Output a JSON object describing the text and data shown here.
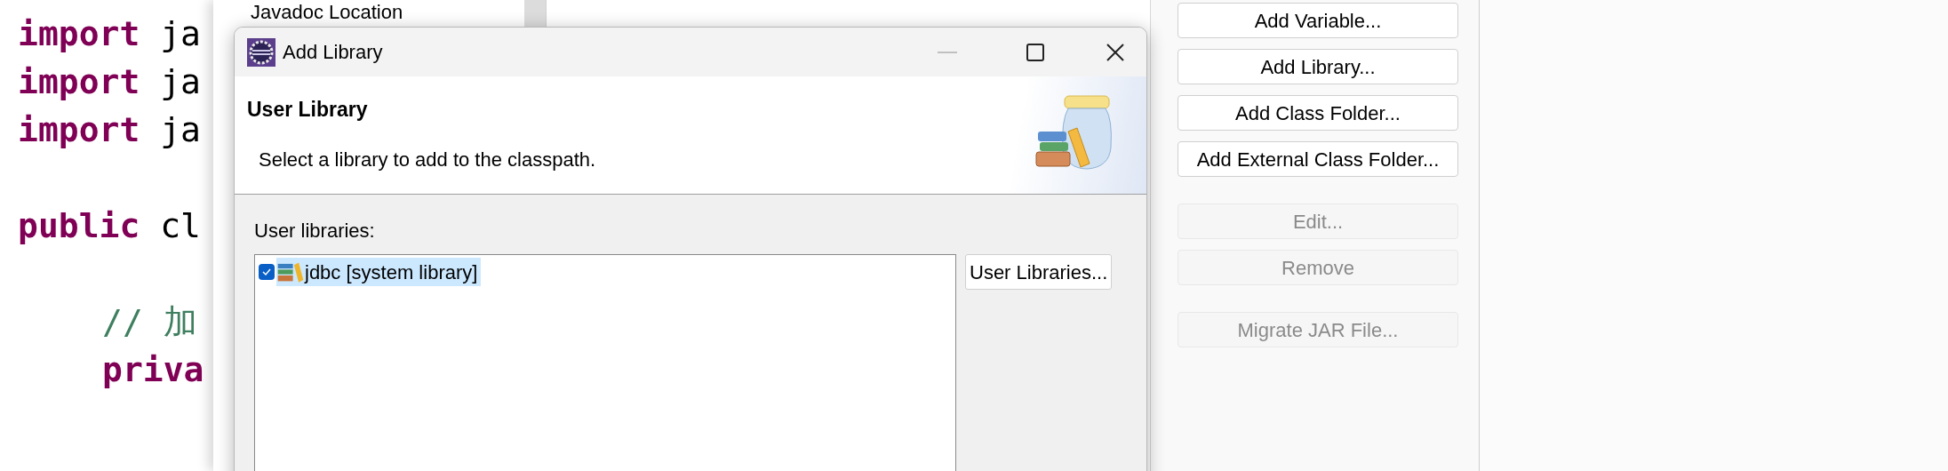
{
  "editor": {
    "lines": [
      {
        "kind": "keyword",
        "keyword": "import",
        "rest": "ja"
      },
      {
        "kind": "keyword",
        "keyword": "import",
        "rest": "ja"
      },
      {
        "kind": "keyword",
        "keyword": "import",
        "rest": "ja"
      },
      {
        "kind": "blank"
      },
      {
        "kind": "keyword",
        "keyword": "public",
        "rest": "cl"
      }
    ],
    "body": [
      {
        "kind": "blank"
      },
      {
        "kind": "comment",
        "text": "// 加"
      },
      {
        "kind": "keyword",
        "keyword": "priva"
      }
    ]
  },
  "properties_window": {
    "left_list": [
      "Javadoc Location"
    ],
    "button_groups": [
      {
        "buttons": [
          {
            "label": "Add Variable...",
            "disabled": false
          },
          {
            "label": "Add Library...",
            "disabled": false
          },
          {
            "label": "Add Class Folder...",
            "disabled": false
          },
          {
            "label": "Add External Class Folder...",
            "disabled": false
          }
        ]
      },
      {
        "buttons": [
          {
            "label": "Edit...",
            "disabled": true
          },
          {
            "label": "Remove",
            "disabled": true
          }
        ]
      },
      {
        "buttons": [
          {
            "label": "Migrate JAR File...",
            "disabled": true
          }
        ]
      }
    ]
  },
  "dialog": {
    "title": "Add Library",
    "header_title": "User Library",
    "description": "Select a library to add to the classpath.",
    "list_label": "User libraries:",
    "libraries": [
      {
        "label": "jdbc [system library]",
        "checked": true,
        "selected": true
      }
    ],
    "side_button": "User Libraries..."
  }
}
